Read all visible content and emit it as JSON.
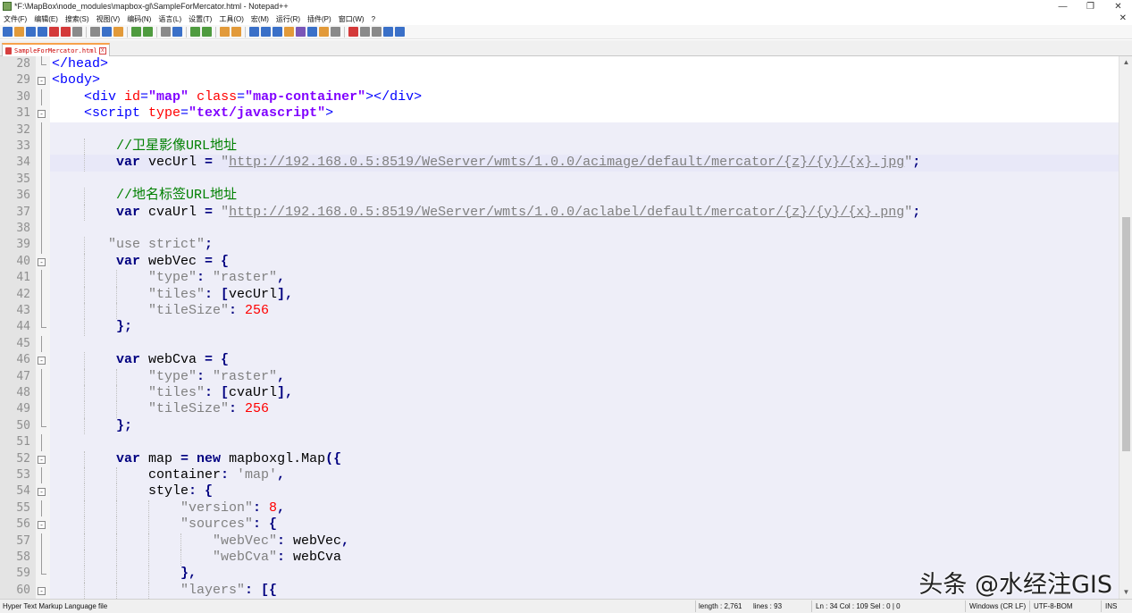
{
  "window": {
    "title": "*F:\\MapBox\\node_modules\\mapbox-gl\\SampleForMercator.html - Notepad++",
    "minimize_glyph": "—",
    "restore_glyph": "❐",
    "close_glyph": "✕"
  },
  "menubar": {
    "items": [
      "文件(F)",
      "编辑(E)",
      "搜索(S)",
      "视图(V)",
      "编码(N)",
      "语言(L)",
      "设置(T)",
      "工具(O)",
      "宏(M)",
      "运行(R)",
      "插件(P)",
      "窗口(W)",
      "?"
    ],
    "close_glyph": "✕"
  },
  "toolbar": {
    "icons": [
      "new-file-icon",
      "open-file-icon",
      "save-icon",
      "save-all-icon",
      "close-icon",
      "close-all-icon",
      "print-icon",
      "cut-icon",
      "copy-icon",
      "paste-icon",
      "undo-icon",
      "redo-icon",
      "find-icon",
      "replace-icon",
      "zoom-in-icon",
      "zoom-out-icon",
      "sync-vertical-icon",
      "sync-horizontal-icon",
      "word-wrap-icon",
      "show-all-chars-icon",
      "indent-guide-icon",
      "user-lang-icon",
      "doc-map-icon",
      "function-list-icon",
      "folder-workspace-icon",
      "monitoring-icon",
      "record-macro-icon",
      "stop-macro-icon",
      "play-macro-icon",
      "run-macro-multiple-icon",
      "save-macro-icon"
    ],
    "colors": {
      "blue": "#3a70c8",
      "green": "#4f9b3f",
      "orange": "#e29a3a",
      "red": "#d43a3a",
      "gray": "#8a8a8a",
      "purple": "#7a56b8"
    }
  },
  "tab": {
    "label": "SampleForMercator.html",
    "close_glyph": "x"
  },
  "editor": {
    "lines": [
      {
        "n": "28",
        "tokens": [
          [
            "t-tag",
            "</head>"
          ]
        ],
        "indent": 0,
        "fold": "end"
      },
      {
        "n": "29",
        "tokens": [
          [
            "t-tag",
            "<body>"
          ]
        ],
        "indent": 0,
        "fold": "open"
      },
      {
        "n": "30",
        "tokens": [
          [
            "t-tag",
            "<div "
          ],
          [
            "t-attr",
            "id"
          ],
          [
            "t-tag",
            "="
          ],
          [
            "t-aval",
            "\"map\""
          ],
          [
            "t-tag",
            " "
          ],
          [
            "t-attr",
            "class"
          ],
          [
            "t-tag",
            "="
          ],
          [
            "t-aval",
            "\"map-container\""
          ],
          [
            "t-tag",
            "></div>"
          ]
        ],
        "indent": 4,
        "fold": "line"
      },
      {
        "n": "31",
        "tokens": [
          [
            "t-tag",
            "<script "
          ],
          [
            "t-attr",
            "type"
          ],
          [
            "t-tag",
            "="
          ],
          [
            "t-aval",
            "\"text/javascript\""
          ],
          [
            "t-tag",
            ">"
          ]
        ],
        "indent": 4,
        "fold": "open"
      },
      {
        "n": "32",
        "tokens": [],
        "indent": 0,
        "fold": "line",
        "bg": "hl-block"
      },
      {
        "n": "33",
        "tokens": [
          [
            "t-cmt",
            "//卫星影像URL地址"
          ]
        ],
        "indent": 8,
        "fold": "line",
        "bg": "hl-block"
      },
      {
        "n": "34",
        "tokens": [
          [
            "t-kw",
            "var"
          ],
          [
            "t-id",
            " vecUrl "
          ],
          [
            "t-op",
            "="
          ],
          [
            "t-id",
            " "
          ],
          [
            "t-str",
            "\""
          ],
          [
            "t-url",
            "http://192.168.0.5:8519/WeServer/wmts/1.0.0/acimage/default/mercator/{z}/{y}/{x}.jpg"
          ],
          [
            "t-str",
            "\""
          ],
          [
            "t-op",
            ";"
          ]
        ],
        "indent": 8,
        "fold": "line",
        "bg": "cur-line"
      },
      {
        "n": "35",
        "tokens": [],
        "indent": 0,
        "fold": "line",
        "bg": "hl-block"
      },
      {
        "n": "36",
        "tokens": [
          [
            "t-cmt",
            "//地名标签URL地址"
          ]
        ],
        "indent": 8,
        "fold": "line",
        "bg": "hl-block"
      },
      {
        "n": "37",
        "tokens": [
          [
            "t-kw",
            "var"
          ],
          [
            "t-id",
            " cvaUrl "
          ],
          [
            "t-op",
            "="
          ],
          [
            "t-id",
            " "
          ],
          [
            "t-str",
            "\""
          ],
          [
            "t-url",
            "http://192.168.0.5:8519/WeServer/wmts/1.0.0/aclabel/default/mercator/{z}/{y}/{x}.png"
          ],
          [
            "t-str",
            "\""
          ],
          [
            "t-op",
            ";"
          ]
        ],
        "indent": 8,
        "fold": "line",
        "bg": "hl-block"
      },
      {
        "n": "38",
        "tokens": [],
        "indent": 0,
        "fold": "line",
        "bg": "hl-block"
      },
      {
        "n": "39",
        "tokens": [
          [
            "t-str",
            "\"use strict\""
          ],
          [
            "t-op",
            ";"
          ]
        ],
        "indent": 7,
        "fold": "line",
        "bg": "hl-block"
      },
      {
        "n": "40",
        "tokens": [
          [
            "t-kw",
            "var"
          ],
          [
            "t-id",
            " webVec "
          ],
          [
            "t-op",
            "= {"
          ]
        ],
        "indent": 8,
        "fold": "open",
        "bg": "hl-block"
      },
      {
        "n": "41",
        "tokens": [
          [
            "t-str",
            "\"type\""
          ],
          [
            "t-op",
            ": "
          ],
          [
            "t-str",
            "\"raster\""
          ],
          [
            "t-op",
            ","
          ]
        ],
        "indent": 12,
        "fold": "line",
        "bg": "hl-block"
      },
      {
        "n": "42",
        "tokens": [
          [
            "t-str",
            "\"tiles\""
          ],
          [
            "t-op",
            ": ["
          ],
          [
            "t-id",
            "vecUrl"
          ],
          [
            "t-op",
            "],"
          ]
        ],
        "indent": 12,
        "fold": "line",
        "bg": "hl-block"
      },
      {
        "n": "43",
        "tokens": [
          [
            "t-str",
            "\"tileSize\""
          ],
          [
            "t-op",
            ": "
          ],
          [
            "t-num",
            "256"
          ]
        ],
        "indent": 12,
        "fold": "line",
        "bg": "hl-block"
      },
      {
        "n": "44",
        "tokens": [
          [
            "t-op",
            "};"
          ]
        ],
        "indent": 8,
        "fold": "end",
        "bg": "hl-block"
      },
      {
        "n": "45",
        "tokens": [],
        "indent": 0,
        "fold": "line",
        "bg": "hl-block"
      },
      {
        "n": "46",
        "tokens": [
          [
            "t-kw",
            "var"
          ],
          [
            "t-id",
            " webCva "
          ],
          [
            "t-op",
            "= {"
          ]
        ],
        "indent": 8,
        "fold": "open",
        "bg": "hl-block"
      },
      {
        "n": "47",
        "tokens": [
          [
            "t-str",
            "\"type\""
          ],
          [
            "t-op",
            ": "
          ],
          [
            "t-str",
            "\"raster\""
          ],
          [
            "t-op",
            ","
          ]
        ],
        "indent": 12,
        "fold": "line",
        "bg": "hl-block"
      },
      {
        "n": "48",
        "tokens": [
          [
            "t-str",
            "\"tiles\""
          ],
          [
            "t-op",
            ": ["
          ],
          [
            "t-id",
            "cvaUrl"
          ],
          [
            "t-op",
            "],"
          ]
        ],
        "indent": 12,
        "fold": "line",
        "bg": "hl-block"
      },
      {
        "n": "49",
        "tokens": [
          [
            "t-str",
            "\"tileSize\""
          ],
          [
            "t-op",
            ": "
          ],
          [
            "t-num",
            "256"
          ]
        ],
        "indent": 12,
        "fold": "line",
        "bg": "hl-block"
      },
      {
        "n": "50",
        "tokens": [
          [
            "t-op",
            "};"
          ]
        ],
        "indent": 8,
        "fold": "end",
        "bg": "hl-block"
      },
      {
        "n": "51",
        "tokens": [],
        "indent": 0,
        "fold": "line",
        "bg": "hl-block"
      },
      {
        "n": "52",
        "tokens": [
          [
            "t-kw",
            "var"
          ],
          [
            "t-id",
            " map "
          ],
          [
            "t-op",
            "= "
          ],
          [
            "t-kw",
            "new"
          ],
          [
            "t-id",
            " mapboxgl.Map"
          ],
          [
            "t-op",
            "({"
          ]
        ],
        "indent": 8,
        "fold": "open",
        "bg": "hl-block"
      },
      {
        "n": "53",
        "tokens": [
          [
            "t-id",
            "container"
          ],
          [
            "t-op",
            ": "
          ],
          [
            "t-str",
            "'map'"
          ],
          [
            "t-op",
            ","
          ]
        ],
        "indent": 12,
        "fold": "line",
        "bg": "hl-block"
      },
      {
        "n": "54",
        "tokens": [
          [
            "t-id",
            "style"
          ],
          [
            "t-op",
            ": {"
          ]
        ],
        "indent": 12,
        "fold": "open",
        "bg": "hl-block"
      },
      {
        "n": "55",
        "tokens": [
          [
            "t-str",
            "\"version\""
          ],
          [
            "t-op",
            ": "
          ],
          [
            "t-num",
            "8"
          ],
          [
            "t-op",
            ","
          ]
        ],
        "indent": 16,
        "fold": "line",
        "bg": "hl-block"
      },
      {
        "n": "56",
        "tokens": [
          [
            "t-str",
            "\"sources\""
          ],
          [
            "t-op",
            ": {"
          ]
        ],
        "indent": 16,
        "fold": "open",
        "bg": "hl-block"
      },
      {
        "n": "57",
        "tokens": [
          [
            "t-str",
            "\"webVec\""
          ],
          [
            "t-op",
            ": "
          ],
          [
            "t-id",
            "webVec"
          ],
          [
            "t-op",
            ","
          ]
        ],
        "indent": 20,
        "fold": "line",
        "bg": "hl-block"
      },
      {
        "n": "58",
        "tokens": [
          [
            "t-str",
            "\"webCva\""
          ],
          [
            "t-op",
            ": "
          ],
          [
            "t-id",
            "webCva"
          ]
        ],
        "indent": 20,
        "fold": "line",
        "bg": "hl-block"
      },
      {
        "n": "59",
        "tokens": [
          [
            "t-op",
            "},"
          ]
        ],
        "indent": 16,
        "fold": "end",
        "bg": "hl-block"
      },
      {
        "n": "60",
        "tokens": [
          [
            "t-str",
            "\"layers\""
          ],
          [
            "t-op",
            ": [{"
          ]
        ],
        "indent": 16,
        "fold": "open",
        "bg": "hl-block"
      }
    ]
  },
  "scrollbar": {
    "up_glyph": "▲",
    "down_glyph": "▼"
  },
  "watermark": "头条 @水经注GIS",
  "statusbar": {
    "file_type": "Hyper Text Markup Language file",
    "length": "length : 2,761",
    "lines": "lines : 93",
    "cursor": "Ln : 34    Col : 109    Sel : 0 | 0",
    "eol": "Windows (CR LF)",
    "encoding": "UTF-8-BOM",
    "mode": "INS"
  }
}
